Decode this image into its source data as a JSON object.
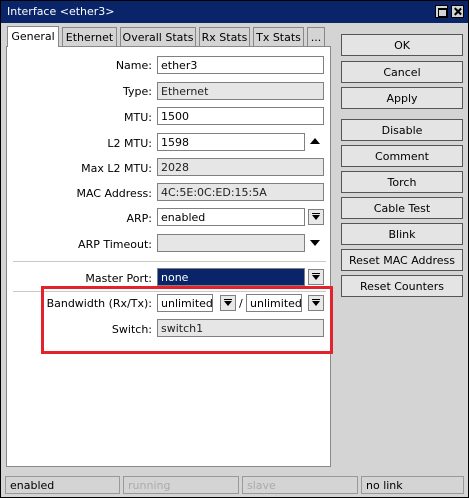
{
  "window": {
    "title": "Interface <ether3>"
  },
  "tabs": [
    "General",
    "Ethernet",
    "Overall Stats",
    "Rx Stats",
    "Tx Stats",
    "..."
  ],
  "form": {
    "name": {
      "label": "Name:",
      "value": "ether3"
    },
    "type": {
      "label": "Type:",
      "value": "Ethernet"
    },
    "mtu": {
      "label": "MTU:",
      "value": "1500"
    },
    "l2mtu": {
      "label": "L2 MTU:",
      "value": "1598"
    },
    "max_l2mtu": {
      "label": "Max L2 MTU:",
      "value": "2028"
    },
    "mac": {
      "label": "MAC Address:",
      "value": "4C:5E:0C:ED:15:5A"
    },
    "arp": {
      "label": "ARP:",
      "value": "enabled"
    },
    "arp_timeout": {
      "label": "ARP Timeout:",
      "value": ""
    },
    "master_port": {
      "label": "Master Port:",
      "value": "none"
    },
    "bandwidth": {
      "label": "Bandwidth (Rx/Tx):",
      "rx": "unlimited",
      "sep": "/",
      "tx": "unlimited"
    },
    "switch": {
      "label": "Switch:",
      "value": "switch1"
    }
  },
  "buttons": [
    "OK",
    "Cancel",
    "Apply",
    "Disable",
    "Comment",
    "Torch",
    "Cable Test",
    "Blink",
    "Reset MAC Address",
    "Reset Counters"
  ],
  "statusbar": [
    "enabled",
    "running",
    "slave",
    "no link"
  ],
  "colors": {
    "titlebar": "#0a246a",
    "highlight": "#e3232c",
    "selected": "#0a246a"
  }
}
